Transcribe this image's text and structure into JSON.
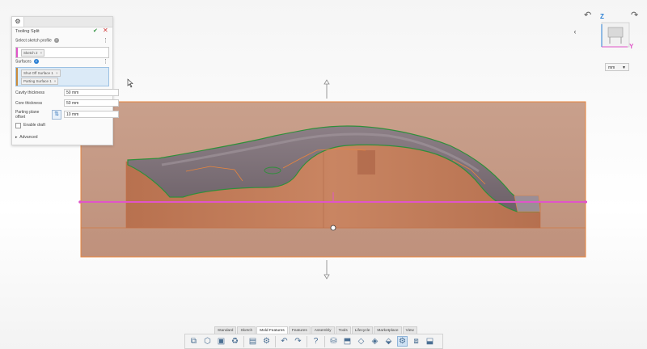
{
  "panel": {
    "title": "Tooling Split",
    "select_sketch_label": "Select sketch profile",
    "sketch_chip": "Sketch 2",
    "surfaces_label": "Surfaces",
    "surfaces_count": "2",
    "surface_chips": [
      "Shut Off Surface 1",
      "Parting Surface 1"
    ],
    "cavity_label": "Cavity thickness",
    "cavity_value": "50 mm",
    "core_label": "Core thickness",
    "core_value": "50 mm",
    "parting_label_1": "Parting plane",
    "parting_label_2": "offset",
    "parting_value": "10 mm",
    "draft_label": "Enable draft",
    "advanced_label": "Advanced"
  },
  "viewcube": {
    "z_label": "Z",
    "y_label": "Y",
    "units": "mm"
  },
  "toolbar": {
    "tabs": [
      "Standard",
      "Sketch",
      "Mold Features",
      "Features",
      "Assembly",
      "Tools",
      "Lifecycle",
      "Marketplace",
      "View"
    ],
    "active_tab": "Mold Features"
  },
  "colors": {
    "accent": "#2a7fd4",
    "parting_line": "#e055c8",
    "mold_block": "#c29682",
    "part_edges": "#2f8f3a",
    "selection_outline": "#e8853d"
  }
}
